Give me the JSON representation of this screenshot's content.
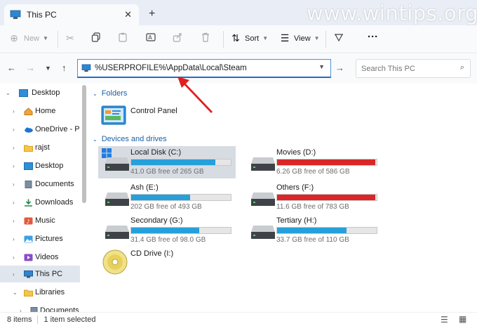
{
  "tab": {
    "title": "This PC",
    "close": "✕",
    "new_tab": "+"
  },
  "watermark": "www.wintips.org",
  "toolbar": {
    "new_label": "New",
    "sort_label": "Sort",
    "view_label": "View",
    "more_label": "···"
  },
  "address": {
    "path": "%USERPROFILE%\\AppData\\Local\\Steam"
  },
  "search": {
    "placeholder": "Search This PC"
  },
  "sidebar": {
    "items": [
      {
        "label": "Desktop",
        "icon": "desktop-icon",
        "expanded": true
      },
      {
        "label": "Home",
        "icon": "home-icon"
      },
      {
        "label": "OneDrive - Per",
        "icon": "cloud-icon"
      },
      {
        "label": "rajst",
        "icon": "folder-icon"
      },
      {
        "label": "Desktop",
        "icon": "desktop-icon"
      },
      {
        "label": "Documents",
        "icon": "document-icon"
      },
      {
        "label": "Downloads",
        "icon": "download-icon"
      },
      {
        "label": "Music",
        "icon": "music-icon"
      },
      {
        "label": "Pictures",
        "icon": "pictures-icon"
      },
      {
        "label": "Videos",
        "icon": "videos-icon"
      },
      {
        "label": "This PC",
        "icon": "computer-icon",
        "selected": true
      },
      {
        "label": "Libraries",
        "icon": "library-icon",
        "expanded": true
      },
      {
        "label": "Documents",
        "icon": "document-icon"
      }
    ]
  },
  "sections": {
    "folders": "Folders",
    "devices": "Devices and drives"
  },
  "folders": [
    {
      "label": "Control Panel",
      "icon": "control-panel-icon"
    }
  ],
  "drives": [
    {
      "name": "Local Disk (C:)",
      "free": "41.0 GB free of 265 GB",
      "used_fraction": 0.845,
      "full": false,
      "selected": true,
      "windows": true
    },
    {
      "name": "Movies (D:)",
      "free": "6.26 GB free of 586 GB",
      "used_fraction": 0.989,
      "full": true
    },
    {
      "name": "Ash (E:)",
      "free": "202 GB free of 493 GB",
      "used_fraction": 0.59,
      "full": false
    },
    {
      "name": "Others (F:)",
      "free": "11.6 GB free of 783 GB",
      "used_fraction": 0.985,
      "full": true
    },
    {
      "name": "Secondary (G:)",
      "free": "31.4 GB free of 98.0 GB",
      "used_fraction": 0.68,
      "full": false
    },
    {
      "name": "Tertiary (H:)",
      "free": "33.7 GB free of 110 GB",
      "used_fraction": 0.694,
      "full": false
    }
  ],
  "cd_drive": {
    "name": "CD Drive (I:)"
  },
  "status": {
    "items": "8 items",
    "selected": "1 item selected"
  },
  "colors": {
    "accent": "#1f6fc5",
    "bar_normal": "#26a0da",
    "bar_full": "#da2626",
    "annotation": "#e02020"
  }
}
